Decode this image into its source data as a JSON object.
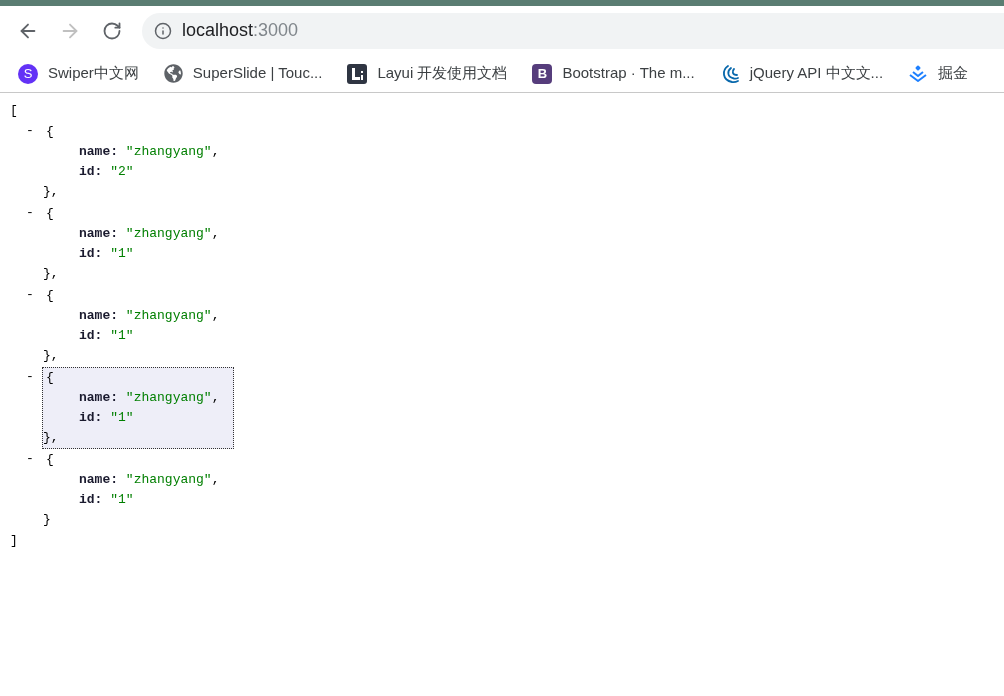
{
  "browser": {
    "back_enabled": true,
    "forward_enabled": false,
    "url_host": "localhost",
    "url_port": ":3000"
  },
  "bookmarks": [
    {
      "kind": "letter-circle",
      "icon_letter": "S",
      "label": "Swiper中文网"
    },
    {
      "kind": "globe",
      "label": "SuperSlide | Touc..."
    },
    {
      "kind": "layui",
      "label": "Layui 开发使用文档"
    },
    {
      "kind": "letter-square",
      "icon_letter": "B",
      "label": "Bootstrap · The m..."
    },
    {
      "kind": "jquery",
      "label": "jQuery API 中文文..."
    },
    {
      "kind": "juejin",
      "label": "掘金"
    }
  ],
  "viewer": {
    "open": "[",
    "close": "]",
    "items": [
      {
        "toggle": "-",
        "expanded": true,
        "selected": false,
        "open": "{",
        "close": "},",
        "fields": [
          {
            "key": "name:",
            "value": "\"zhangyang\"",
            "comma": ","
          },
          {
            "key": "id:",
            "value": "\"2\""
          }
        ]
      },
      {
        "toggle": "-",
        "expanded": true,
        "selected": false,
        "open": "{",
        "close": "},",
        "fields": [
          {
            "key": "name:",
            "value": "\"zhangyang\"",
            "comma": ","
          },
          {
            "key": "id:",
            "value": "\"1\""
          }
        ]
      },
      {
        "toggle": "-",
        "expanded": true,
        "selected": false,
        "open": "{",
        "close": "},",
        "fields": [
          {
            "key": "name:",
            "value": "\"zhangyang\"",
            "comma": ","
          },
          {
            "key": "id:",
            "value": "\"1\""
          }
        ]
      },
      {
        "toggle": "-",
        "expanded": true,
        "selected": true,
        "open": "{",
        "close": "},",
        "fields": [
          {
            "key": "name:",
            "value": "\"zhangyang\"",
            "comma": ","
          },
          {
            "key": "id:",
            "value": "\"1\""
          }
        ]
      },
      {
        "toggle": "-",
        "expanded": true,
        "selected": false,
        "open": "{",
        "close": "}",
        "fields": [
          {
            "key": "name:",
            "value": "\"zhangyang\"",
            "comma": ","
          },
          {
            "key": "id:",
            "value": "\"1\""
          }
        ]
      }
    ]
  }
}
